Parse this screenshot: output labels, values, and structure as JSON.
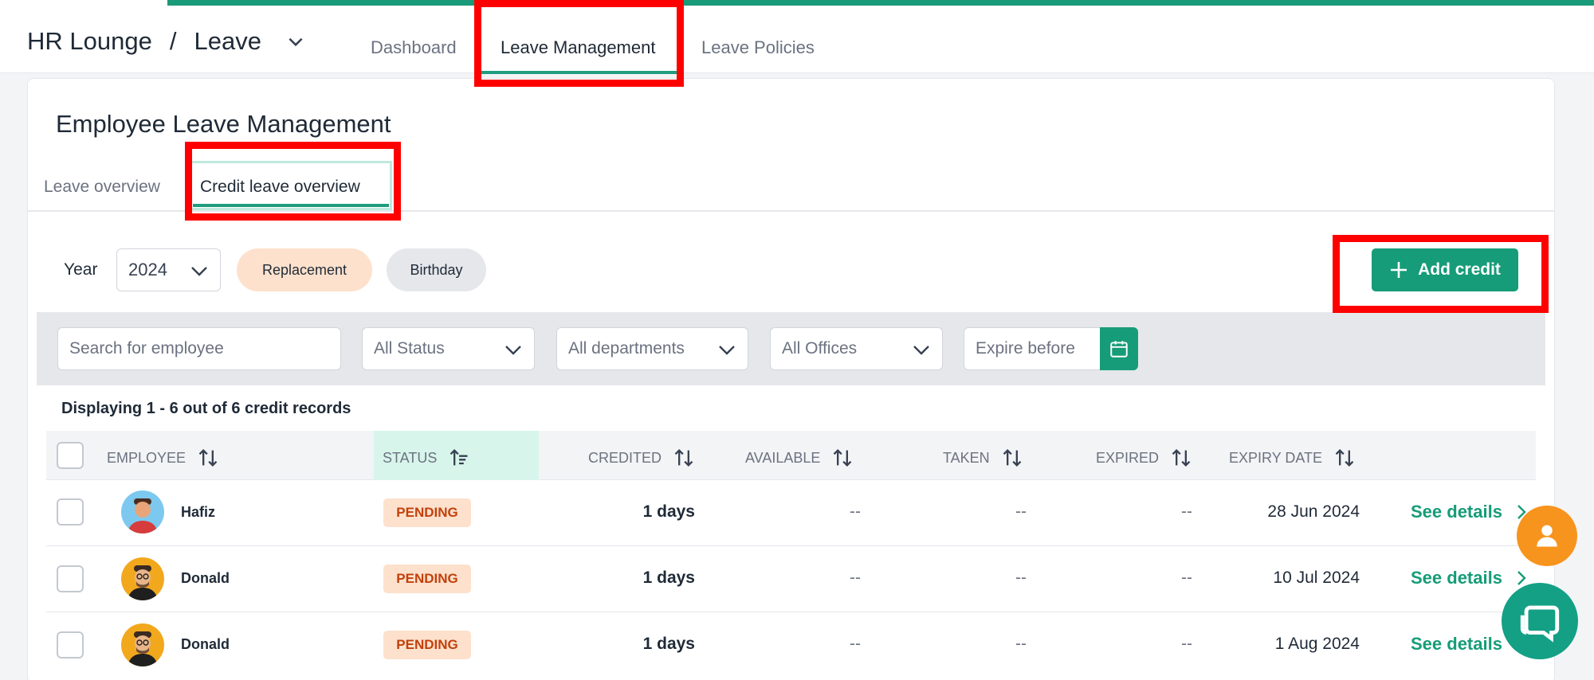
{
  "header": {
    "breadcrumb_root": "HR Lounge",
    "breadcrumb_sep": "/",
    "breadcrumb_current": "Leave",
    "tabs": [
      {
        "label": "Dashboard"
      },
      {
        "label": "Leave Management"
      },
      {
        "label": "Leave Policies"
      }
    ],
    "active_tab": "Leave Management"
  },
  "page": {
    "title": "Employee Leave Management",
    "subtabs": [
      {
        "label": "Leave overview"
      },
      {
        "label": "Credit leave overview"
      }
    ],
    "active_subtab": "Credit leave overview"
  },
  "toolbar": {
    "year_label": "Year",
    "year_value": "2024",
    "chips": [
      {
        "label": "Replacement",
        "selected": true
      },
      {
        "label": "Birthday",
        "selected": false
      }
    ],
    "add_credit_label": "Add credit"
  },
  "filters": {
    "search_placeholder": "Search for employee",
    "status_value": "All Status",
    "department_value": "All departments",
    "office_value": "All Offices",
    "expire_placeholder": "Expire before"
  },
  "summary": "Displaying 1 - 6 out of 6 credit records",
  "table": {
    "columns": [
      "EMPLOYEE",
      "STATUS",
      "CREDITED",
      "AVAILABLE",
      "TAKEN",
      "EXPIRED",
      "EXPIRY DATE"
    ],
    "rows": [
      {
        "employee": "Hafiz",
        "status": "PENDING",
        "credited": "1 days",
        "available": "--",
        "taken": "--",
        "expired": "--",
        "expiry_date": "28 Jun 2024",
        "action": "See details"
      },
      {
        "employee": "Donald",
        "status": "PENDING",
        "credited": "1 days",
        "available": "--",
        "taken": "--",
        "expired": "--",
        "expiry_date": "10 Jul 2024",
        "action": "See details"
      },
      {
        "employee": "Donald",
        "status": "PENDING",
        "credited": "1 days",
        "available": "--",
        "taken": "--",
        "expired": "--",
        "expiry_date": "1 Aug 2024",
        "action": "See details"
      }
    ]
  },
  "colors": {
    "accent": "#169c78",
    "pending_bg": "#fde1cc",
    "pending_text": "#c2410c",
    "highlight_box": "#ff0000",
    "fab_orange": "#f7941d"
  },
  "icons": [
    "chevron-down-icon",
    "sort-icon",
    "sort-active-icon",
    "plus-icon",
    "calendar-icon",
    "chevron-right-icon",
    "user-icon",
    "chat-icon"
  ]
}
